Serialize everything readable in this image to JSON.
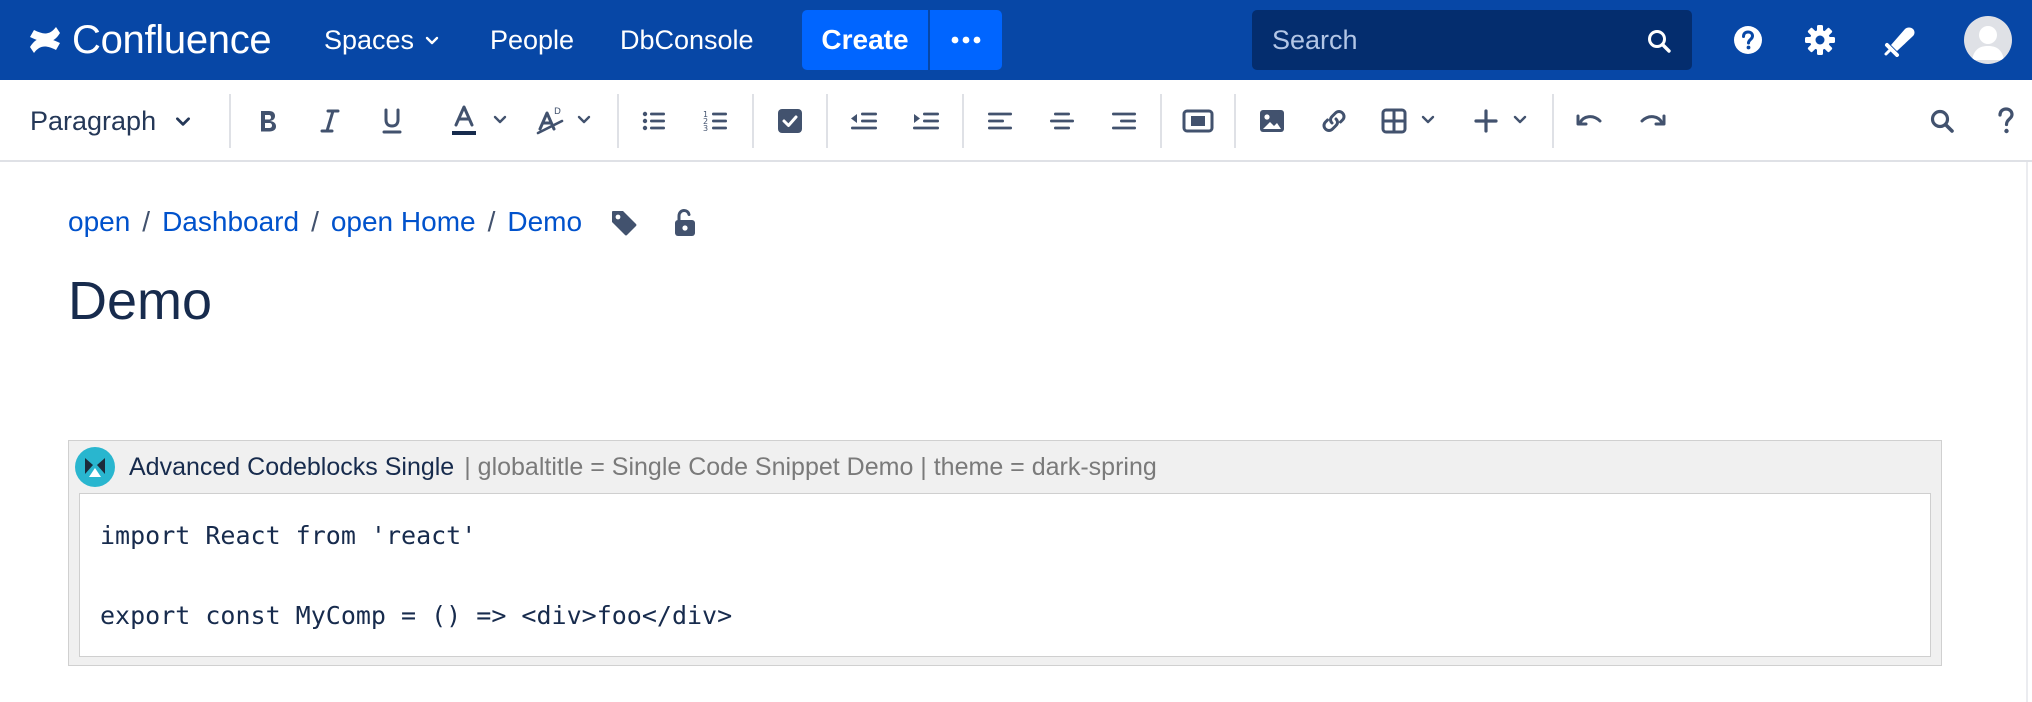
{
  "topnav": {
    "logo_text": "Confluence",
    "items": [
      {
        "label": "Spaces",
        "has_dropdown": true
      },
      {
        "label": "People",
        "has_dropdown": false
      },
      {
        "label": "DbConsole",
        "has_dropdown": false
      }
    ],
    "create_label": "Create",
    "more_icon": "more-icon",
    "search_placeholder": "Search",
    "right_icons": [
      "help-icon",
      "gear-icon",
      "notifications-icon",
      "avatar"
    ],
    "colors": {
      "bar": "#0747a6",
      "create": "#0065ff",
      "search_bg": "#042d6e"
    }
  },
  "toolbar": {
    "paragraph_label": "Paragraph",
    "buttons": [
      "bold-icon",
      "italic-icon",
      "underline-icon",
      "text-color-icon",
      "clear-format-icon",
      "bullet-list-icon",
      "numbered-list-icon",
      "task-list-icon",
      "outdent-icon",
      "indent-icon",
      "align-left-icon",
      "align-center-icon",
      "align-right-icon",
      "page-layout-icon",
      "image-icon",
      "link-icon",
      "table-icon",
      "insert-more-icon",
      "undo-icon",
      "redo-icon",
      "find-replace-icon",
      "help-icon"
    ]
  },
  "breadcrumb": {
    "items": [
      "open",
      "Dashboard",
      "open Home",
      "Demo"
    ],
    "separator": "/"
  },
  "page": {
    "title": "Demo"
  },
  "macro": {
    "name": "Advanced Codeblocks Single",
    "params": "| globaltitle = Single Code Snippet Demo | theme = dark-spring",
    "code_lines": [
      "import React from 'react'",
      "",
      "export const MyComp = () => <div>foo</div>"
    ]
  }
}
